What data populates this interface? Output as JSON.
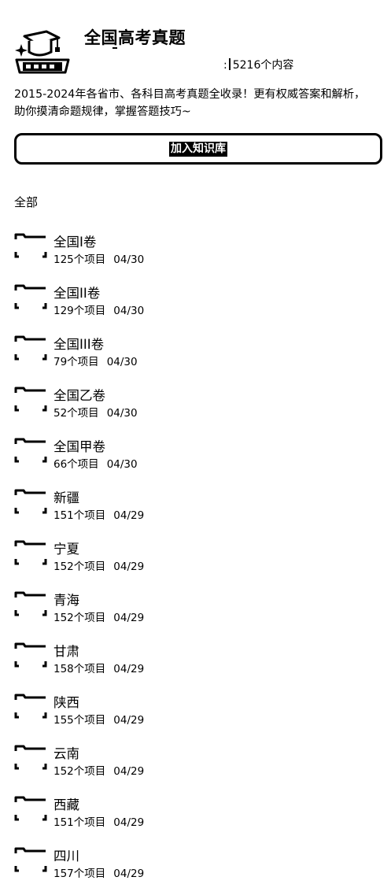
{
  "header": {
    "title": "全国高考真题",
    "meta_prefix": ":",
    "content_count": "5216个内容",
    "logo": "graduation-cap-logo"
  },
  "description": {
    "line1": "2015-2024年各省市、各科目高考真题全收录！更有权威答案和解析，",
    "line2": "助你摸清命题规律，掌握答题技巧~"
  },
  "join_button": {
    "label": "加入知识库"
  },
  "section": {
    "label": "全部"
  },
  "folders": [
    {
      "name": "全国I卷",
      "count": "125个项目",
      "date": "04/30"
    },
    {
      "name": "全国II卷",
      "count": "129个项目",
      "date": "04/30"
    },
    {
      "name": "全国III卷",
      "count": "79个项目",
      "date": "04/30"
    },
    {
      "name": "全国乙卷",
      "count": "52个项目",
      "date": "04/30"
    },
    {
      "name": "全国甲卷",
      "count": "66个项目",
      "date": "04/30"
    },
    {
      "name": "新疆",
      "count": "151个项目",
      "date": "04/29"
    },
    {
      "name": "宁夏",
      "count": "152个项目",
      "date": "04/29"
    },
    {
      "name": "青海",
      "count": "152个项目",
      "date": "04/29"
    },
    {
      "name": "甘肃",
      "count": "158个项目",
      "date": "04/29"
    },
    {
      "name": "陕西",
      "count": "155个项目",
      "date": "04/29"
    },
    {
      "name": "云南",
      "count": "152个项目",
      "date": "04/29"
    },
    {
      "name": "西藏",
      "count": "151个项目",
      "date": "04/29"
    },
    {
      "name": "四川",
      "count": "157个项目",
      "date": "04/29"
    }
  ],
  "icons": {
    "folder": "folder-icon"
  },
  "colors": {
    "foreground": "#000000",
    "background": "#ffffff"
  }
}
